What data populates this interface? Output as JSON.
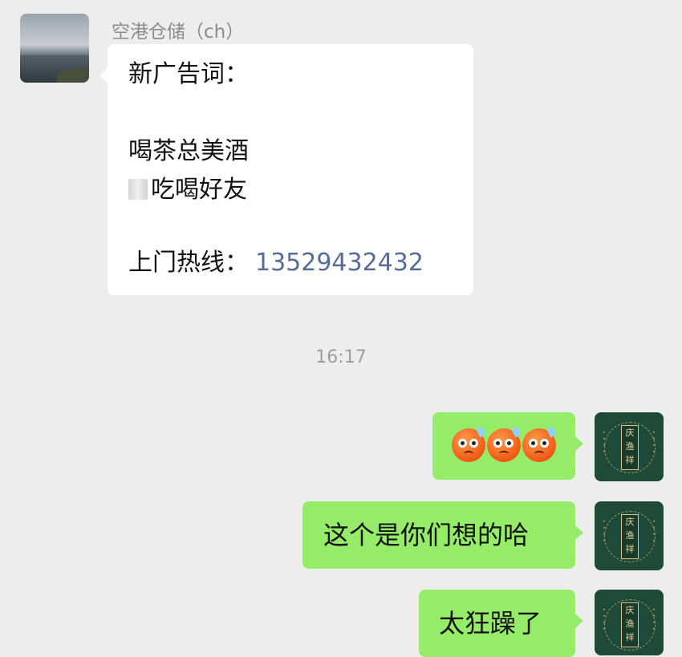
{
  "incoming": {
    "sender_name": "空港仓储（ch）",
    "message_lines": [
      "新广告词：",
      "喝茶总美酒",
      "吃喝好友",
      "上门热线："
    ],
    "phone_number": "13529432432"
  },
  "timestamp": "16:17",
  "outgoing": {
    "emoji_name": "sweat-worried-face-icon",
    "message_2": "这个是你们想的哈",
    "message_3": "太狂躁了"
  },
  "avatar_right": {
    "seal_text": "庆渔祥"
  },
  "colors": {
    "background": "#ededed",
    "incoming_bubble": "#ffffff",
    "outgoing_bubble": "#95ec69",
    "phone_link": "#576b95"
  }
}
